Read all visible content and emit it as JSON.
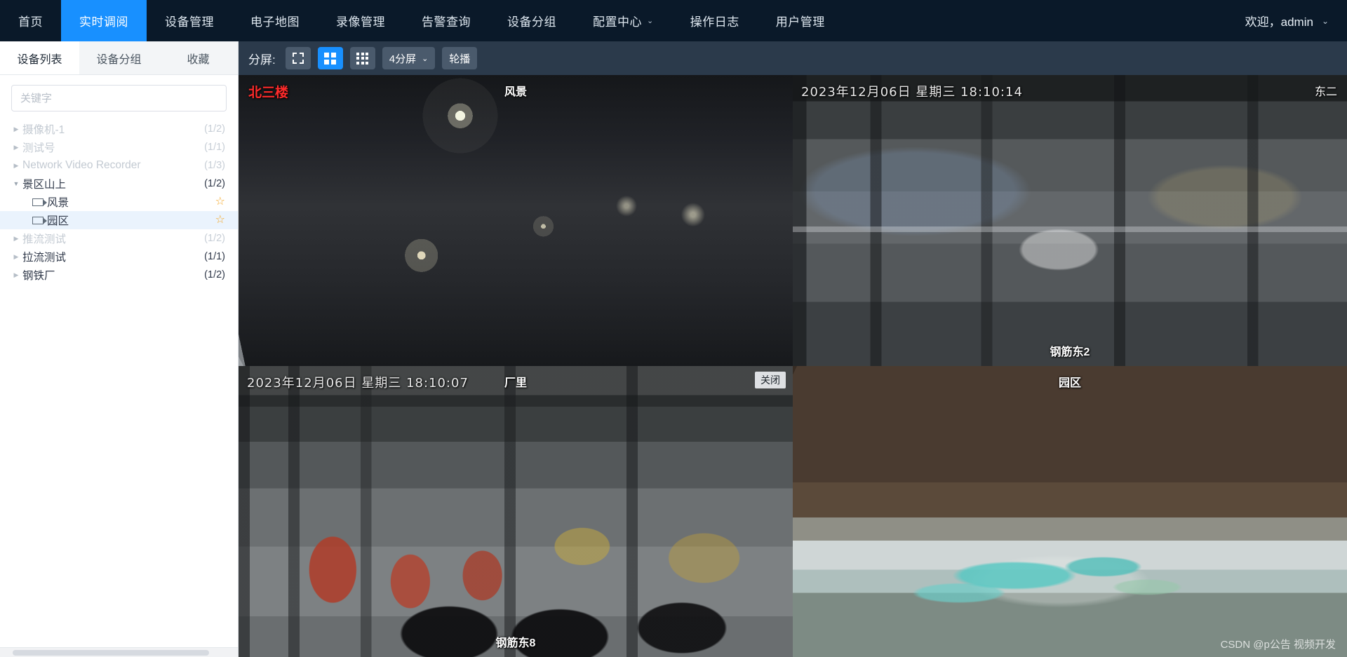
{
  "topnav": {
    "items": [
      {
        "label": "首页",
        "active": false,
        "caret": false
      },
      {
        "label": "实时调阅",
        "active": true,
        "caret": false
      },
      {
        "label": "设备管理",
        "active": false,
        "caret": false
      },
      {
        "label": "电子地图",
        "active": false,
        "caret": false
      },
      {
        "label": "录像管理",
        "active": false,
        "caret": false
      },
      {
        "label": "告警查询",
        "active": false,
        "caret": false
      },
      {
        "label": "设备分组",
        "active": false,
        "caret": false
      },
      {
        "label": "配置中心",
        "active": false,
        "caret": true
      },
      {
        "label": "操作日志",
        "active": false,
        "caret": false
      },
      {
        "label": "用户管理",
        "active": false,
        "caret": false
      }
    ],
    "user": "欢迎，admin",
    "caret_glyph": "⌄"
  },
  "sidebar": {
    "tabs": [
      {
        "label": "设备列表",
        "active": true
      },
      {
        "label": "设备分组",
        "active": false
      },
      {
        "label": "收藏",
        "active": false
      }
    ],
    "search_placeholder": "关键字",
    "search_value": "",
    "tree": [
      {
        "label": "摄像机-1",
        "count": "(1/2)",
        "dim": true,
        "arrow": "▶",
        "child": false,
        "selected": false,
        "star": false
      },
      {
        "label": "测试号",
        "count": "(1/1)",
        "dim": true,
        "arrow": "▶",
        "child": false,
        "selected": false,
        "star": false
      },
      {
        "label": "Network Video Recorder",
        "count": "(1/3)",
        "dim": true,
        "arrow": "▶",
        "child": false,
        "selected": false,
        "star": false
      },
      {
        "label": "景区山上",
        "count": "(1/2)",
        "dim": false,
        "arrow": "▼",
        "child": false,
        "selected": false,
        "star": false
      },
      {
        "label": "风景",
        "count": "",
        "dim": false,
        "arrow": "",
        "child": true,
        "selected": false,
        "star": true
      },
      {
        "label": "园区",
        "count": "",
        "dim": false,
        "arrow": "",
        "child": true,
        "selected": true,
        "star": true
      },
      {
        "label": "推流测试",
        "count": "(1/2)",
        "dim": true,
        "arrow": "▶",
        "child": false,
        "selected": false,
        "star": false
      },
      {
        "label": "拉流测试",
        "count": "(1/1)",
        "dim": false,
        "arrow": "▶",
        "child": false,
        "selected": false,
        "star": false
      },
      {
        "label": "钢铁厂",
        "count": "(1/2)",
        "dim": false,
        "arrow": "▶",
        "child": false,
        "selected": false,
        "star": false
      }
    ],
    "star_glyph": "☆"
  },
  "toolbar": {
    "split_label": "分屏:",
    "fullscreen_icon": "fullscreen-icon",
    "grid4_icon": "grid-4-icon",
    "grid9_icon": "grid-9-icon",
    "layout_select": "4分屏",
    "layout_caret": "⌄",
    "carousel_label": "轮播"
  },
  "cells": [
    {
      "name": "风景",
      "corner_label": "北三楼",
      "title": "风景",
      "timestamp": "",
      "bottom_label": "",
      "close_label": "",
      "active": true
    },
    {
      "name": "东二",
      "corner_label": "东二",
      "title": "",
      "timestamp": "2023年12月06日 星期三 18:10:14",
      "bottom_label": "钢筋东2",
      "close_label": "",
      "active": false
    },
    {
      "name": "厂里",
      "corner_label": "",
      "title": "厂里",
      "timestamp": "2023年12月06日 星期三 18:10:07",
      "bottom_label": "钢筋东8",
      "close_label": "关闭",
      "active": false
    },
    {
      "name": "园区",
      "corner_label": "",
      "title": "园区",
      "timestamp": "",
      "bottom_label": "",
      "close_label": "",
      "active": false
    }
  ],
  "watermark": "CSDN @p公告 视频开发",
  "colors": {
    "nav_bg": "#0a1929",
    "accent": "#1890ff",
    "toolbar_bg": "#2b3a4b",
    "active_cell_border": "#ff1f1f",
    "star": "#f5a623"
  }
}
